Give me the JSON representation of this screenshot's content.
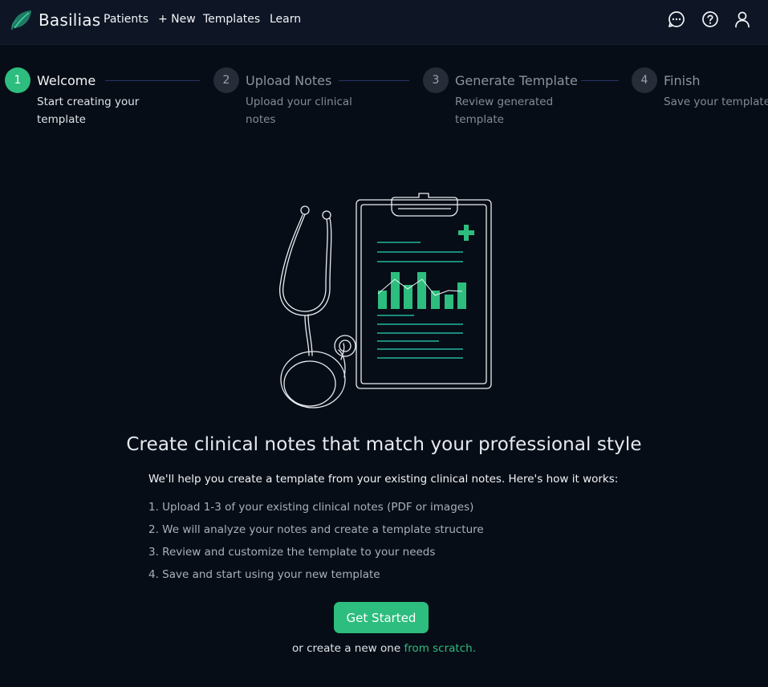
{
  "app": {
    "name": "Basilias",
    "accent": "#2dbd7e"
  },
  "nav": {
    "links": [
      {
        "label": "Patients"
      },
      {
        "label": "+ New"
      },
      {
        "label": "Templates"
      },
      {
        "label": "Learn"
      }
    ],
    "icons": [
      "chat-icon",
      "help-icon",
      "user-icon"
    ]
  },
  "stepper": {
    "current": 1,
    "steps": [
      {
        "number": "1",
        "title": "Welcome",
        "description": "Start creating your template"
      },
      {
        "number": "2",
        "title": "Upload Notes",
        "description": "Upload your clinical notes"
      },
      {
        "number": "3",
        "title": "Generate Template",
        "description": "Review generated template"
      },
      {
        "number": "4",
        "title": "Finish",
        "description": "Save your template"
      }
    ]
  },
  "main": {
    "headline": "Create clinical notes that match your professional style",
    "intro": "We'll help you create a template from your existing clinical notes. Here's how it works:",
    "how_it_works": [
      "1. Upload 1-3 of your existing clinical notes (PDF or images)",
      "2. We will analyze your notes and create a template structure",
      "3. Review and customize the template to your needs",
      "4. Save and start using your new template"
    ],
    "cta_label": "Get Started",
    "alt_prefix": "or create a new one",
    "alt_link": "from scratch."
  },
  "illustration": {
    "icons": [
      "stethoscope-icon",
      "clipboard-icon",
      "medical-cross-icon",
      "bar-chart-icon"
    ]
  }
}
